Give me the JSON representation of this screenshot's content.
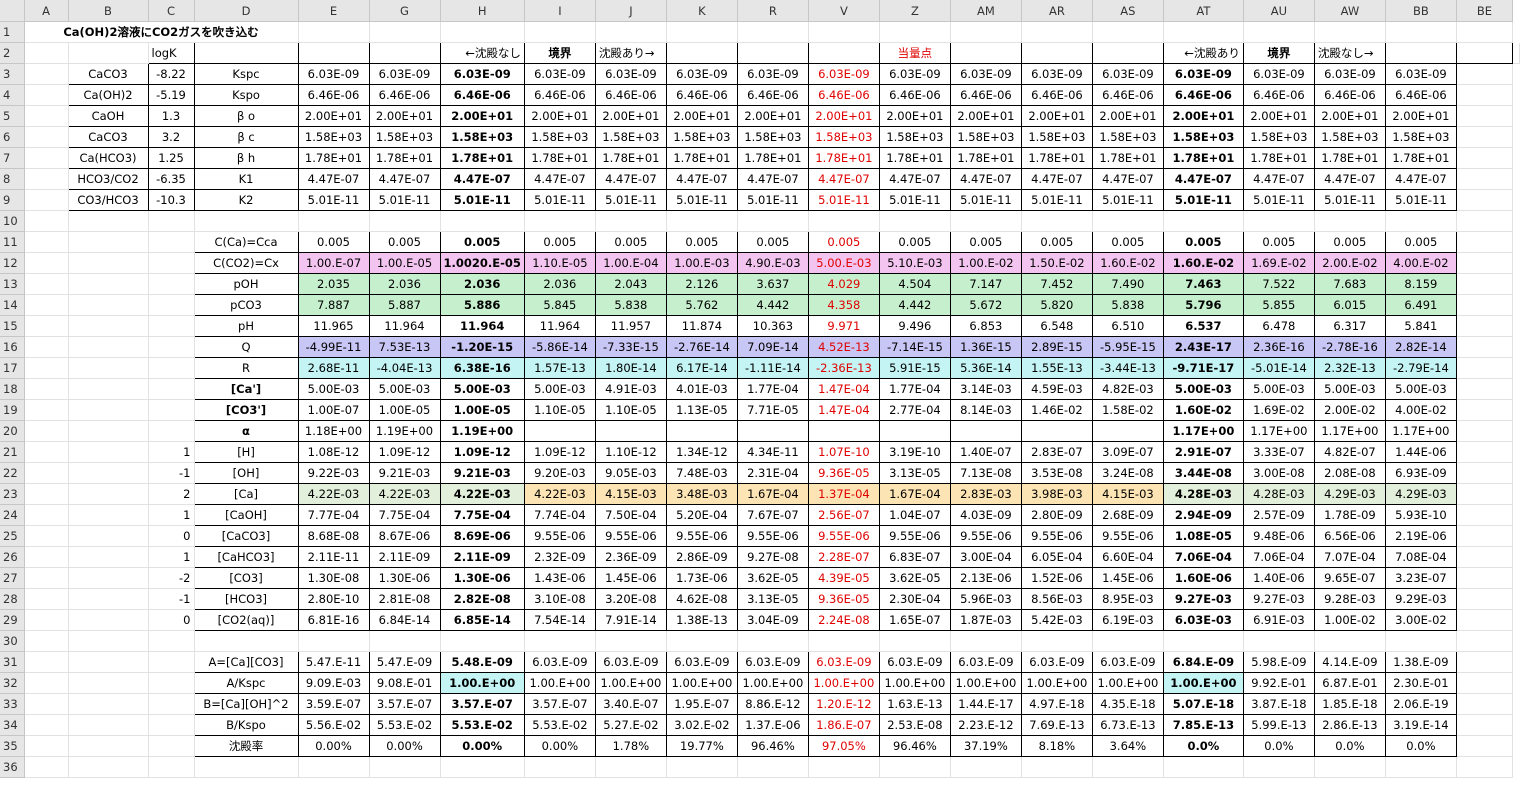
{
  "columns": [
    "A",
    "B",
    "C",
    "D",
    "E",
    "G",
    "H",
    "I",
    "J",
    "K",
    "R",
    "V",
    "Z",
    "AM",
    "AR",
    "AS",
    "AT",
    "AU",
    "AW",
    "BB",
    "BE"
  ],
  "title": "Ca(OH)2溶液にCO2ガスを吹き込む",
  "row2": {
    "logK": "logK",
    "G": "←沈殿なし",
    "H": "境界",
    "I": "沈殿あり→",
    "V": "当量点",
    "AS": "←沈殿あり",
    "AT": "境界",
    "AU": "沈殿なし→"
  },
  "params": [
    {
      "B": "CaCO3",
      "C": "-8.22",
      "D": "Kspc",
      "v": "6.03E-09"
    },
    {
      "B": "Ca(OH)2",
      "C": "-5.19",
      "D": "Kspo",
      "v": "6.46E-06"
    },
    {
      "B": "CaOH",
      "C": "1.3",
      "D": "β o",
      "v": "2.00E+01"
    },
    {
      "B": "CaCO3",
      "C": "3.2",
      "D": "β c",
      "v": "1.58E+03"
    },
    {
      "B": "Ca(HCO3)",
      "C": "1.25",
      "D": "β h",
      "v": "1.78E+01"
    },
    {
      "B": "HCO3/CO2",
      "C": "-6.35",
      "D": "K1",
      "v": "4.47E-07"
    },
    {
      "B": "CO3/HCO3",
      "C": "-10.3",
      "D": "K2",
      "v": "5.01E-11"
    }
  ],
  "block2": [
    {
      "row": "11",
      "C": "",
      "D": "C(Ca)=Cca",
      "vals": [
        "0.005",
        "0.005",
        "0.005",
        "0.005",
        "0.005",
        "0.005",
        "0.005",
        "0.005",
        "0.005",
        "0.005",
        "0.005",
        "0.005",
        "0.005",
        "0.005",
        "0.005",
        "0.005"
      ]
    },
    {
      "row": "12",
      "C": "",
      "D": "C(CO2)=Cx",
      "vals": [
        "1.00.E-07",
        "1.00.E-05",
        "1.0020.E-05",
        "1.10.E-05",
        "1.00.E-04",
        "1.00.E-03",
        "4.90.E-03",
        "5.00.E-03",
        "5.10.E-03",
        "1.00.E-02",
        "1.50.E-02",
        "1.60.E-02",
        "1.60.E-02",
        "1.69.E-02",
        "2.00.E-02",
        "4.00.E-02"
      ]
    },
    {
      "row": "13",
      "C": "",
      "D": "pOH",
      "vals": [
        "2.035",
        "2.036",
        "2.036",
        "2.036",
        "2.043",
        "2.126",
        "3.637",
        "4.029",
        "4.504",
        "7.147",
        "7.452",
        "7.490",
        "7.463",
        "7.522",
        "7.683",
        "8.159"
      ]
    },
    {
      "row": "14",
      "C": "",
      "D": "pCO3",
      "vals": [
        "7.887",
        "5.887",
        "5.886",
        "5.845",
        "5.838",
        "5.762",
        "4.442",
        "4.358",
        "4.442",
        "5.672",
        "5.820",
        "5.838",
        "5.796",
        "5.855",
        "6.015",
        "6.491"
      ]
    },
    {
      "row": "15",
      "C": "",
      "D": "pH",
      "vals": [
        "11.965",
        "11.964",
        "11.964",
        "11.964",
        "11.957",
        "11.874",
        "10.363",
        "9.971",
        "9.496",
        "6.853",
        "6.548",
        "6.510",
        "6.537",
        "6.478",
        "6.317",
        "5.841"
      ]
    },
    {
      "row": "16",
      "C": "",
      "D": "Q",
      "vals": [
        "-4.99E-11",
        "7.53E-13",
        "-1.20E-15",
        "-5.86E-14",
        "-7.33E-15",
        "-2.76E-14",
        "7.09E-14",
        "4.52E-13",
        "-7.14E-15",
        "1.36E-15",
        "2.89E-15",
        "-5.95E-15",
        "2.43E-17",
        "2.36E-16",
        "-2.78E-16",
        "2.82E-14"
      ]
    },
    {
      "row": "17",
      "C": "",
      "D": "R",
      "vals": [
        "2.68E-11",
        "-4.04E-13",
        "6.38E-16",
        "1.57E-13",
        "1.80E-14",
        "6.17E-14",
        "-1.11E-14",
        "-2.36E-13",
        "5.91E-15",
        "5.36E-14",
        "1.55E-13",
        "-3.44E-13",
        "-9.71E-17",
        "-5.01E-14",
        "2.32E-13",
        "-2.79E-14"
      ]
    },
    {
      "row": "18",
      "C": "",
      "D": "[Ca']",
      "vals": [
        "5.00E-03",
        "5.00E-03",
        "5.00E-03",
        "5.00E-03",
        "4.91E-03",
        "4.01E-03",
        "1.77E-04",
        "1.47E-04",
        "1.77E-04",
        "3.14E-03",
        "4.59E-03",
        "4.82E-03",
        "5.00E-03",
        "5.00E-03",
        "5.00E-03",
        "5.00E-03"
      ]
    },
    {
      "row": "19",
      "C": "",
      "D": "[CO3']",
      "vals": [
        "1.00E-07",
        "1.00E-05",
        "1.00E-05",
        "1.10E-05",
        "1.10E-05",
        "1.13E-05",
        "7.71E-05",
        "1.47E-04",
        "2.77E-04",
        "8.14E-03",
        "1.46E-02",
        "1.58E-02",
        "1.60E-02",
        "1.69E-02",
        "2.00E-02",
        "4.00E-02"
      ]
    },
    {
      "row": "20",
      "C": "",
      "D": "α",
      "vals": [
        "1.18E+00",
        "1.19E+00",
        "1.19E+00",
        "",
        "",
        "",
        "",
        "",
        "",
        "",
        "",
        "",
        "1.17E+00",
        "1.17E+00",
        "1.17E+00",
        "1.17E+00"
      ]
    },
    {
      "row": "21",
      "C": "1",
      "D": "[H]",
      "vals": [
        "1.08E-12",
        "1.09E-12",
        "1.09E-12",
        "1.09E-12",
        "1.10E-12",
        "1.34E-12",
        "4.34E-11",
        "1.07E-10",
        "3.19E-10",
        "1.40E-07",
        "2.83E-07",
        "3.09E-07",
        "2.91E-07",
        "3.33E-07",
        "4.82E-07",
        "1.44E-06"
      ]
    },
    {
      "row": "22",
      "C": "-1",
      "D": "[OH]",
      "vals": [
        "9.22E-03",
        "9.21E-03",
        "9.21E-03",
        "9.20E-03",
        "9.05E-03",
        "7.48E-03",
        "2.31E-04",
        "9.36E-05",
        "3.13E-05",
        "7.13E-08",
        "3.53E-08",
        "3.24E-08",
        "3.44E-08",
        "3.00E-08",
        "2.08E-08",
        "6.93E-09"
      ]
    },
    {
      "row": "23",
      "C": "2",
      "D": "[Ca]",
      "vals": [
        "4.22E-03",
        "4.22E-03",
        "4.22E-03",
        "4.22E-03",
        "4.15E-03",
        "3.48E-03",
        "1.67E-04",
        "1.37E-04",
        "1.67E-04",
        "2.83E-03",
        "3.98E-03",
        "4.15E-03",
        "4.28E-03",
        "4.28E-03",
        "4.29E-03",
        "4.29E-03"
      ]
    },
    {
      "row": "24",
      "C": "1",
      "D": "[CaOH]",
      "vals": [
        "7.77E-04",
        "7.75E-04",
        "7.75E-04",
        "7.74E-04",
        "7.50E-04",
        "5.20E-04",
        "7.67E-07",
        "2.56E-07",
        "1.04E-07",
        "4.03E-09",
        "2.80E-09",
        "2.68E-09",
        "2.94E-09",
        "2.57E-09",
        "1.78E-09",
        "5.93E-10"
      ]
    },
    {
      "row": "25",
      "C": "0",
      "D": "[CaCO3]",
      "vals": [
        "8.68E-08",
        "8.67E-06",
        "8.69E-06",
        "9.55E-06",
        "9.55E-06",
        "9.55E-06",
        "9.55E-06",
        "9.55E-06",
        "9.55E-06",
        "9.55E-06",
        "9.55E-06",
        "9.55E-06",
        "1.08E-05",
        "9.48E-06",
        "6.56E-06",
        "2.19E-06"
      ]
    },
    {
      "row": "26",
      "C": "1",
      "D": "[CaHCO3]",
      "vals": [
        "2.11E-11",
        "2.11E-09",
        "2.11E-09",
        "2.32E-09",
        "2.36E-09",
        "2.86E-09",
        "9.27E-08",
        "2.28E-07",
        "6.83E-07",
        "3.00E-04",
        "6.05E-04",
        "6.60E-04",
        "7.06E-04",
        "7.06E-04",
        "7.07E-04",
        "7.08E-04"
      ]
    },
    {
      "row": "27",
      "C": "-2",
      "D": "[CO3]",
      "vals": [
        "1.30E-08",
        "1.30E-06",
        "1.30E-06",
        "1.43E-06",
        "1.45E-06",
        "1.73E-06",
        "3.62E-05",
        "4.39E-05",
        "3.62E-05",
        "2.13E-06",
        "1.52E-06",
        "1.45E-06",
        "1.60E-06",
        "1.40E-06",
        "9.65E-07",
        "3.23E-07"
      ]
    },
    {
      "row": "28",
      "C": "-1",
      "D": "[HCO3]",
      "vals": [
        "2.80E-10",
        "2.81E-08",
        "2.82E-08",
        "3.10E-08",
        "3.20E-08",
        "4.62E-08",
        "3.13E-05",
        "9.36E-05",
        "2.30E-04",
        "5.96E-03",
        "8.56E-03",
        "8.95E-03",
        "9.27E-03",
        "9.27E-03",
        "9.28E-03",
        "9.29E-03"
      ]
    },
    {
      "row": "29",
      "C": "0",
      "D": "[CO2(aq)]",
      "vals": [
        "6.81E-16",
        "6.84E-14",
        "6.85E-14",
        "7.54E-14",
        "7.91E-14",
        "1.38E-13",
        "3.04E-09",
        "2.24E-08",
        "1.65E-07",
        "1.87E-03",
        "5.42E-03",
        "6.19E-03",
        "6.03E-03",
        "6.91E-03",
        "1.00E-02",
        "3.00E-02"
      ]
    }
  ],
  "block3": [
    {
      "row": "31",
      "D": "A=[Ca][CO3]",
      "vals": [
        "5.47.E-11",
        "5.47.E-09",
        "5.48.E-09",
        "6.03.E-09",
        "6.03.E-09",
        "6.03.E-09",
        "6.03.E-09",
        "6.03.E-09",
        "6.03.E-09",
        "6.03.E-09",
        "6.03.E-09",
        "6.03.E-09",
        "6.84.E-09",
        "5.98.E-09",
        "4.14.E-09",
        "1.38.E-09"
      ]
    },
    {
      "row": "32",
      "D": "A/Kspc",
      "vals": [
        "9.09.E-03",
        "9.08.E-01",
        "1.00.E+00",
        "1.00.E+00",
        "1.00.E+00",
        "1.00.E+00",
        "1.00.E+00",
        "1.00.E+00",
        "1.00.E+00",
        "1.00.E+00",
        "1.00.E+00",
        "1.00.E+00",
        "1.00.E+00",
        "9.92.E-01",
        "6.87.E-01",
        "2.30.E-01"
      ]
    },
    {
      "row": "33",
      "D": "B=[Ca][OH]^2",
      "vals": [
        "3.59.E-07",
        "3.57.E-07",
        "3.57.E-07",
        "3.57.E-07",
        "3.40.E-07",
        "1.95.E-07",
        "8.86.E-12",
        "1.20.E-12",
        "1.63.E-13",
        "1.44.E-17",
        "4.97.E-18",
        "4.35.E-18",
        "5.07.E-18",
        "3.87.E-18",
        "1.85.E-18",
        "2.06.E-19"
      ]
    },
    {
      "row": "34",
      "D": "B/Kspo",
      "vals": [
        "5.56.E-02",
        "5.53.E-02",
        "5.53.E-02",
        "5.53.E-02",
        "5.27.E-02",
        "3.02.E-02",
        "1.37.E-06",
        "1.86.E-07",
        "2.53.E-08",
        "2.23.E-12",
        "7.69.E-13",
        "6.73.E-13",
        "7.85.E-13",
        "5.99.E-13",
        "2.86.E-13",
        "3.19.E-14"
      ]
    },
    {
      "row": "35",
      "D": "沈殿率",
      "vals": [
        "0.00%",
        "0.00%",
        "0.00%",
        "0.00%",
        "1.78%",
        "19.77%",
        "96.46%",
        "97.05%",
        "96.46%",
        "37.19%",
        "8.18%",
        "3.64%",
        "0.0%",
        "0.0%",
        "0.0%",
        "0.0%"
      ]
    }
  ],
  "colors": {
    "pink": "#f4c4f0",
    "green": "#c6efce",
    "purple": "#c8c6f4",
    "cyan": "#c4f4f4",
    "orange": "#fce4b4",
    "lightgreen": "#e2efda",
    "red": "#e00000"
  }
}
